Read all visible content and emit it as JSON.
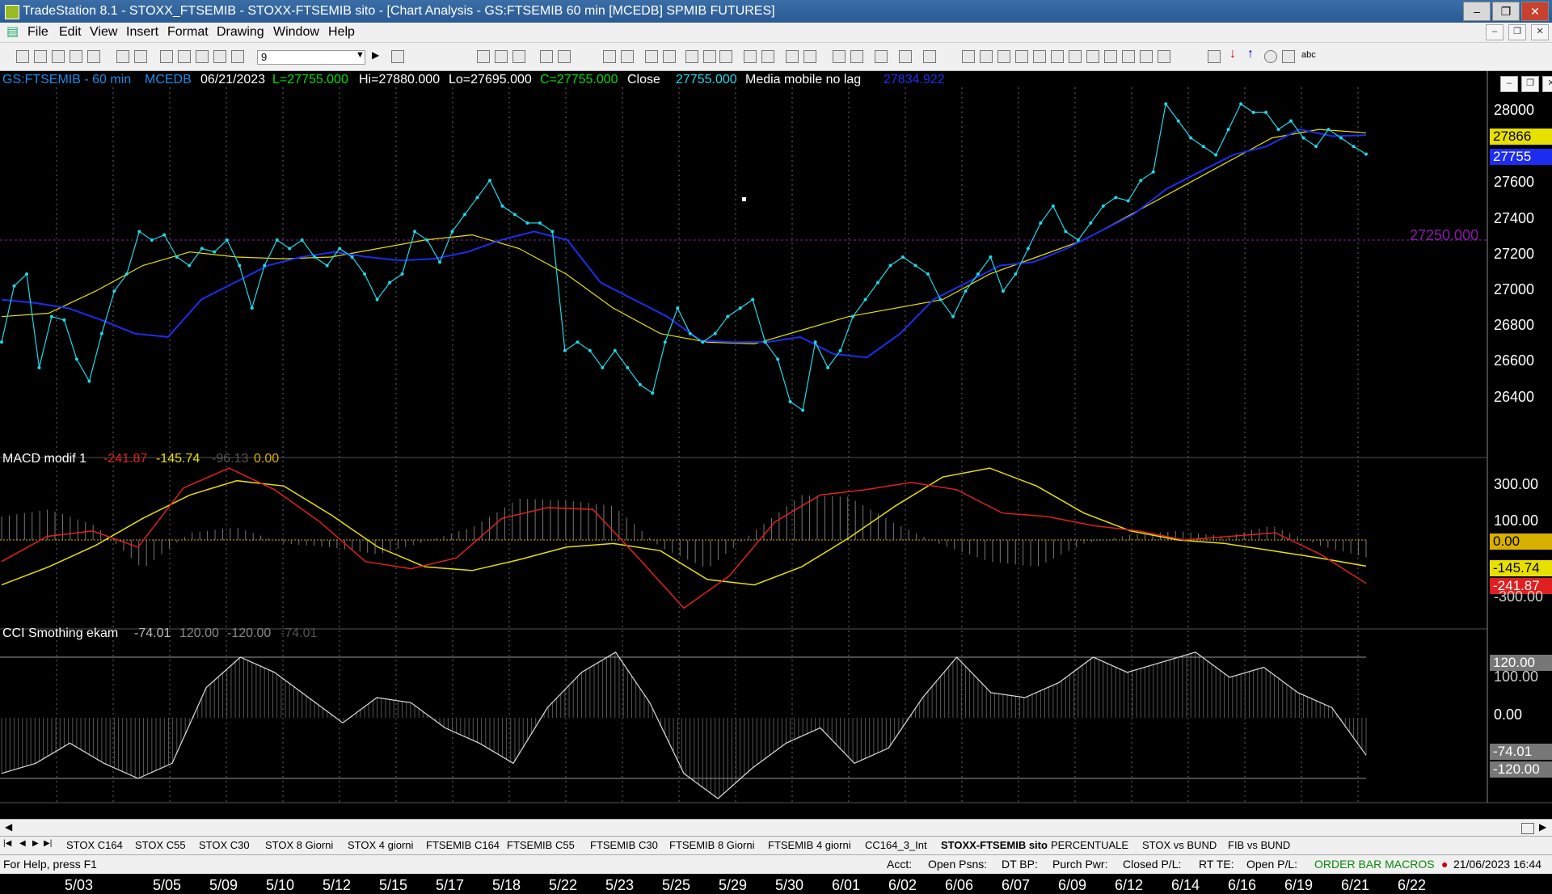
{
  "window": {
    "title": "TradeStation 8.1 - STOXX_FTSEMIB - STOXX-FTSEMIB sito - [Chart Analysis - GS:FTSEMIB  60 min  [MCEDB] SPMIB FUTURES]"
  },
  "menu": [
    "File",
    "Edit",
    "View",
    "Insert",
    "Format",
    "Drawing",
    "Window",
    "Help"
  ],
  "toolbar": {
    "interval_value": "9"
  },
  "header": {
    "symbol": "GS:FTSEMIB - 60 min",
    "data_series": "MCEDB",
    "date": "06/21/2023",
    "last": "L=27755.000",
    "high": "Hi=27880.000",
    "low": "Lo=27695.000",
    "close": "C=27755.000",
    "close_label": "Close",
    "close_value": "27755.000",
    "ma_label": "Media mobile no lag",
    "ma_value": "27834.922"
  },
  "macd": {
    "label": "MACD modif 1",
    "v1": "-241.87",
    "v2": "-145.74",
    "v3": "-96.13",
    "v4": "0.00"
  },
  "cci": {
    "label": "CCI Smothing ekam",
    "v1": "-74.01",
    "v2": "120.00",
    "v3": "-120.00",
    "v4": "-74.01"
  },
  "price_axis": [
    "28000",
    "27600",
    "27400",
    "27200",
    "27000",
    "26800",
    "26600",
    "26400"
  ],
  "price_boxes": {
    "ma_yellow": "27866",
    "close_blue": "27755",
    "hline": "27250.000"
  },
  "macd_axis": [
    "300.00",
    "100.00",
    "0.00",
    "-145.74",
    "-241.87",
    "-300.00"
  ],
  "cci_axis": [
    "120.00",
    "100.00",
    "0.00",
    "-74.01",
    "-120.00"
  ],
  "dates": [
    "5/03",
    "5/05",
    "5/09",
    "5/10",
    "5/12",
    "5/15",
    "5/17",
    "5/18",
    "5/22",
    "5/23",
    "5/25",
    "5/29",
    "5/30",
    "6/01",
    "6/02",
    "6/06",
    "6/07",
    "6/09",
    "6/12",
    "6/14",
    "6/16",
    "6/19",
    "6/21",
    "6/22"
  ],
  "tabs": [
    "STOX C164",
    "STOX C55",
    "STOX  C30",
    "STOX  8 Giorni",
    "STOX 4 giorni",
    "FTSEMIB C164",
    "FTSEMIB C55",
    "FTSEMIB C30",
    "FTSEMIB  8 Giorni",
    "FTSEMIB  4 giorni",
    "CC164_3_Int",
    "STOXX-FTSEMIB sito",
    "PERCENTUALE",
    "STOX vs BUND",
    "FIB vs BUND"
  ],
  "active_tab": "STOXX-FTSEMIB sito",
  "status": {
    "help": "For Help, press F1",
    "acct": "Acct:",
    "open_psns": "Open Psns:",
    "dt_bp": "DT BP:",
    "purch_pwr": "Purch Pwr:",
    "closed_pl": "Closed P/L:",
    "rt_te": "RT TE:",
    "open_pl": "Open P/L:",
    "macros": "ORDER BAR  MACROS",
    "datetime": "21/06/2023 16:44"
  },
  "colors": {
    "cyan": "#1fd8e8",
    "blue": "#1c2df0",
    "yellow": "#e8e000",
    "red": "#e02020",
    "green": "#00e000",
    "purple": "#8a1aa8"
  },
  "chart_data": [
    {
      "type": "line",
      "title": "GS:FTSEMIB - 60 min",
      "y_axis_ticks": [
        26400,
        26600,
        26800,
        27000,
        27200,
        27400,
        27600,
        28000
      ],
      "ylim": [
        26200,
        28100
      ],
      "horizontal_line": 27250,
      "series": [
        {
          "name": "Close",
          "values": [
            26650,
            26980,
            27050,
            26500,
            26800,
            26780,
            26550,
            26420,
            26700,
            26950,
            27050,
            27300,
            27250,
            27280,
            27150,
            27100,
            27200,
            27180,
            27250,
            27100,
            26850,
            27100,
            27250,
            27200,
            27250,
            27150,
            27100,
            27200,
            27150,
            27050,
            26900,
            27000,
            27050,
            27300,
            27250,
            27120,
            27300,
            27400,
            27500,
            27600,
            27450,
            27400,
            27350,
            27350,
            27300,
            26600,
            26650,
            26600,
            26500,
            26600,
            26500,
            26400,
            26350,
            26650,
            26850,
            26700,
            26650,
            26700,
            26800,
            26850,
            26900,
            26650,
            26550,
            26300,
            26250,
            26650,
            26500,
            26600,
            26800,
            26900,
            27000,
            27100,
            27150,
            27100,
            27050,
            26900,
            26800,
            26950,
            27050,
            27150,
            26950,
            27050,
            27200,
            27350,
            27450,
            27300,
            27250,
            27350,
            27450,
            27500,
            27480,
            27600,
            27650,
            28050,
            27950,
            27850,
            27800,
            27750,
            27900,
            28050,
            28000,
            28000,
            27900,
            27950,
            27850,
            27800,
            27900,
            27850,
            27800,
            27755
          ]
        },
        {
          "name": "Media mobile no lag",
          "values": [
            26900,
            26880,
            26850,
            26780,
            26700,
            26680,
            26900,
            27000,
            27100,
            27150,
            27180,
            27150,
            27130,
            27140,
            27180,
            27250,
            27300,
            27250,
            27000,
            26900,
            26800,
            26660,
            26650,
            26650,
            26680,
            26580,
            26560,
            26700,
            26900,
            27000,
            27100,
            27120,
            27200,
            27300,
            27400,
            27550,
            27650,
            27750,
            27800,
            27900,
            27860,
            27866
          ]
        },
        {
          "name": "Average (yellow)",
          "values": [
            26800,
            26820,
            26950,
            27100,
            27180,
            27150,
            27140,
            27150,
            27200,
            27250,
            27280,
            27200,
            27050,
            26850,
            26700,
            26650,
            26640,
            26720,
            26800,
            26850,
            26900,
            27050,
            27150,
            27250,
            27400,
            27550,
            27700,
            27850,
            27900,
            27880
          ]
        }
      ]
    },
    {
      "type": "line",
      "title": "MACD modif 1",
      "ylim": [
        -450,
        450
      ],
      "series": [
        {
          "name": "MACD (red)",
          "values": [
            -120,
            20,
            50,
            -40,
            290,
            400,
            280,
            100,
            -120,
            -160,
            -100,
            120,
            180,
            170,
            -100,
            -380,
            -200,
            100,
            250,
            280,
            320,
            280,
            150,
            130,
            80,
            50,
            0,
            20,
            40,
            -80,
            -241.87
          ]
        },
        {
          "name": "Signal (yellow)",
          "values": [
            -250,
            -150,
            -30,
            120,
            250,
            330,
            300,
            140,
            -40,
            -150,
            -170,
            -110,
            -40,
            -20,
            -60,
            -220,
            -250,
            -150,
            10,
            190,
            350,
            400,
            300,
            150,
            50,
            0,
            -20,
            -60,
            -100,
            -145.74
          ]
        },
        {
          "name": "Histogram",
          "values": [
            130,
            170,
            80,
            -160,
            40,
            70,
            -20,
            -40,
            -80,
            -10,
            70,
            230,
            220,
            190,
            -40,
            -160,
            50,
            250,
            240,
            90,
            -30,
            -120,
            -150,
            -20,
            30,
            50,
            20,
            80,
            -30,
            -96.13
          ]
        }
      ]
    },
    {
      "type": "line",
      "title": "CCI Smothing ekam",
      "ylim": [
        -160,
        160
      ],
      "horizontal_lines": [
        120,
        -120
      ],
      "series": [
        {
          "name": "CCI",
          "values": [
            -110,
            -90,
            -50,
            -90,
            -120,
            -90,
            60,
            120,
            90,
            40,
            -10,
            40,
            30,
            -20,
            -50,
            -90,
            20,
            90,
            130,
            30,
            -110,
            -160,
            -100,
            -50,
            -20,
            -90,
            -60,
            40,
            120,
            50,
            40,
            70,
            120,
            90,
            110,
            130,
            80,
            100,
            50,
            20,
            -74.01
          ]
        }
      ]
    }
  ]
}
